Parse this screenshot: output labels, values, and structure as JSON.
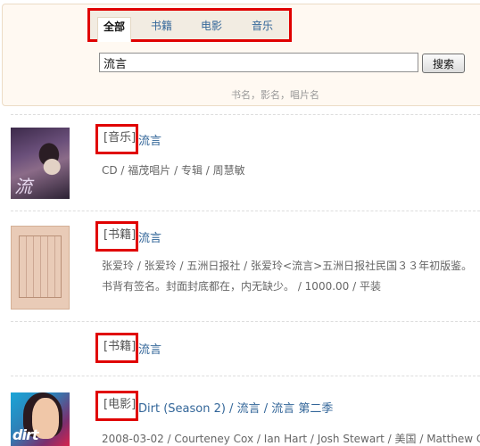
{
  "search": {
    "tabs": [
      {
        "label": "全部",
        "active": true
      },
      {
        "label": "书籍",
        "active": false
      },
      {
        "label": "电影",
        "active": false
      },
      {
        "label": "音乐",
        "active": false
      }
    ],
    "query": "流言",
    "button_label": "搜索",
    "hint": "书名，影名，唱片名"
  },
  "results": [
    {
      "type_tag": "[音乐]",
      "title": "流言",
      "meta": "CD / 福茂唱片 / 专辑 / 周慧敏",
      "cover_icon": "album-cover"
    },
    {
      "type_tag": "[书籍]",
      "title": "流言",
      "meta": "张爱玲 / 张爱玲 / 五洲日报社 / 张爱玲<流言>五洲日报社民国３３年初版鉴。书背有签名。封面封底都在，内无缺少。 / 1000.00 / 平装",
      "cover_icon": "book-cover"
    },
    {
      "type_tag": "[书籍]",
      "title": "流言",
      "meta": ""
    },
    {
      "type_tag": "[电影]",
      "title": "Dirt (Season 2) / 流言 / 流言 第二季",
      "meta": "2008-03-02 / Courteney Cox / Ian Hart / Josh Stewart / 美国 / Matthew Ca",
      "cover_icon": "dvd-cover",
      "cover_text": "dirt"
    }
  ],
  "colors": {
    "link": "#336699",
    "highlight_border": "#e00000",
    "panel_bg": "#fff9f2",
    "hint_text": "#999999"
  }
}
